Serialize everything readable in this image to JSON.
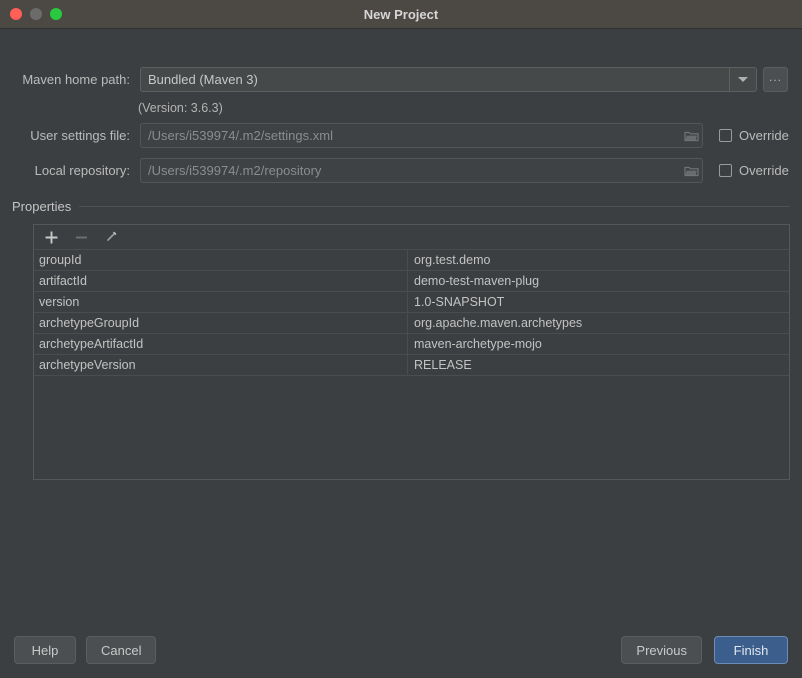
{
  "window": {
    "title": "New Project",
    "traffic_lights": [
      {
        "name": "close",
        "color": "#ff5f57"
      },
      {
        "name": "minimize",
        "color": "#6b6b6b"
      },
      {
        "name": "zoom",
        "color": "#28c840"
      }
    ]
  },
  "form": {
    "maven_home": {
      "label": "Maven home path:",
      "value": "Bundled (Maven 3)",
      "browse_label": "...",
      "version_note": "(Version: 3.6.3)"
    },
    "user_settings": {
      "label": "User settings file:",
      "value": "/Users/i539974/.m2/settings.xml",
      "override_label": "Override",
      "override_checked": false
    },
    "local_repository": {
      "label": "Local repository:",
      "value": "/Users/i539974/.m2/repository",
      "override_label": "Override",
      "override_checked": false
    }
  },
  "properties": {
    "group_title": "Properties",
    "toolbar": {
      "add": "+",
      "remove": "−",
      "edit": "edit-pencil"
    },
    "rows": [
      {
        "key": "groupId",
        "value": "org.test.demo"
      },
      {
        "key": "artifactId",
        "value": "demo-test-maven-plug"
      },
      {
        "key": "version",
        "value": "1.0-SNAPSHOT"
      },
      {
        "key": "archetypeGroupId",
        "value": "org.apache.maven.archetypes"
      },
      {
        "key": "archetypeArtifactId",
        "value": "maven-archetype-mojo"
      },
      {
        "key": "archetypeVersion",
        "value": "RELEASE"
      }
    ]
  },
  "footer": {
    "help": "Help",
    "cancel": "Cancel",
    "previous": "Previous",
    "finish": "Finish"
  },
  "colors": {
    "background": "#3c3f41",
    "titlebar": "#4c4844",
    "accent": "#3c5e8c",
    "text": "#bbbbbb"
  }
}
